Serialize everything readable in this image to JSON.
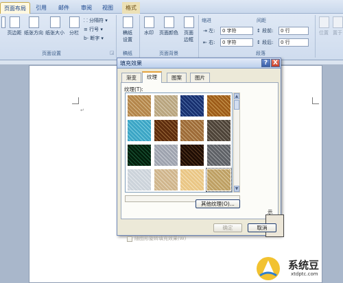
{
  "ribbon": {
    "tabs": [
      "页面布局",
      "引用",
      "邮件",
      "审阅",
      "视图",
      "格式"
    ],
    "buttons": {
      "margins": "页边距",
      "orientation": "纸张方向",
      "size": "纸张大小",
      "columns": "分栏",
      "breaks": "分隔符",
      "line_numbers": "行号",
      "hyphenation": "断字",
      "draft": "稿纸设置",
      "watermark": "水印",
      "page_color": "页面颜色",
      "page_borders": "页面边框",
      "protect": "位置",
      "bring_front": "置于"
    },
    "indent": {
      "title": "缩进",
      "left_label": "左:",
      "left_value": "0 字符",
      "right_label": "右:",
      "right_value": "0 字符"
    },
    "spacing": {
      "title": "间距",
      "before_label": "段前:",
      "before_value": "0 行",
      "after_label": "段后:",
      "after_value": "0 行"
    },
    "groups": [
      "页面设置",
      "稿纸",
      "页面背景",
      "段落"
    ]
  },
  "dialog": {
    "title": "填充效果",
    "help": "?",
    "close": "X",
    "tabs": [
      "渐变",
      "纹理",
      "图案",
      "图片"
    ],
    "texture_label": "纹理(T):",
    "other_texture": "其他纹理(O)...",
    "rotate_checkbox": "随图形旋转填充效果(W)",
    "sample_label": "示例:",
    "ok": "确定",
    "cancel": "取消",
    "textures": [
      {
        "name": "texture-1",
        "color": "#d6b98a"
      },
      {
        "name": "texture-2",
        "color": "#d9cdb4"
      },
      {
        "name": "texture-3",
        "color": "#4f6fa8"
      },
      {
        "name": "texture-4",
        "color": "#c99a52"
      },
      {
        "name": "texture-5",
        "color": "#7ccde0"
      },
      {
        "name": "texture-6",
        "color": "#9a6a3a"
      },
      {
        "name": "texture-7",
        "color": "#c8a577"
      },
      {
        "name": "texture-8",
        "color": "#8c8377"
      },
      {
        "name": "texture-9",
        "color": "#1c5b3a"
      },
      {
        "name": "texture-10",
        "color": "#c9ccd3"
      },
      {
        "name": "texture-11",
        "color": "#5a3b22"
      },
      {
        "name": "texture-12",
        "color": "#9b9da1"
      },
      {
        "name": "texture-13",
        "color": "#e4e8ec"
      },
      {
        "name": "texture-14",
        "color": "#e6d7bd"
      },
      {
        "name": "texture-15",
        "color": "#f4e1b8"
      },
      {
        "name": "texture-16",
        "color": "#dccaa0"
      }
    ],
    "selected_texture": "texture-16"
  },
  "watermark": {
    "brand": "系统豆",
    "site": "xtdptc.com"
  }
}
